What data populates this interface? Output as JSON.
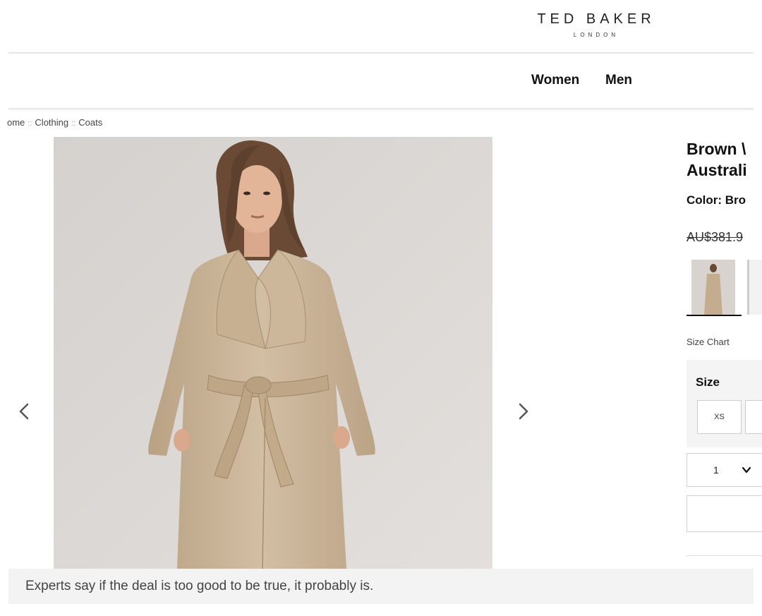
{
  "header": {
    "brand_name": "TED BAKER",
    "brand_sub": "LONDON",
    "nav": [
      "Women",
      "Men"
    ]
  },
  "breadcrumb": [
    "ome",
    "Clothing",
    "Coats"
  ],
  "breadcrumb_separator": "::",
  "gallery": {
    "prev_icon": "chevron-left-icon",
    "next_icon": "chevron-right-icon"
  },
  "product": {
    "title_lines": [
      "Brown \\",
      "Australi"
    ],
    "color_label": "Color: Bro",
    "price_original": "AU$381.9",
    "size_chart_label": "Size Chart",
    "size_heading": "Size",
    "sizes": [
      "XS"
    ],
    "quantity": "1",
    "quantity_icon": "chevron-down-icon"
  },
  "caption": "Experts say if the deal is too good to be true, it probably is.",
  "colors": {
    "background": "#ffffff",
    "caption_bg": "#f3f3f3",
    "photo_bg": "#d9d5d2",
    "coat": "#c9b49a"
  }
}
